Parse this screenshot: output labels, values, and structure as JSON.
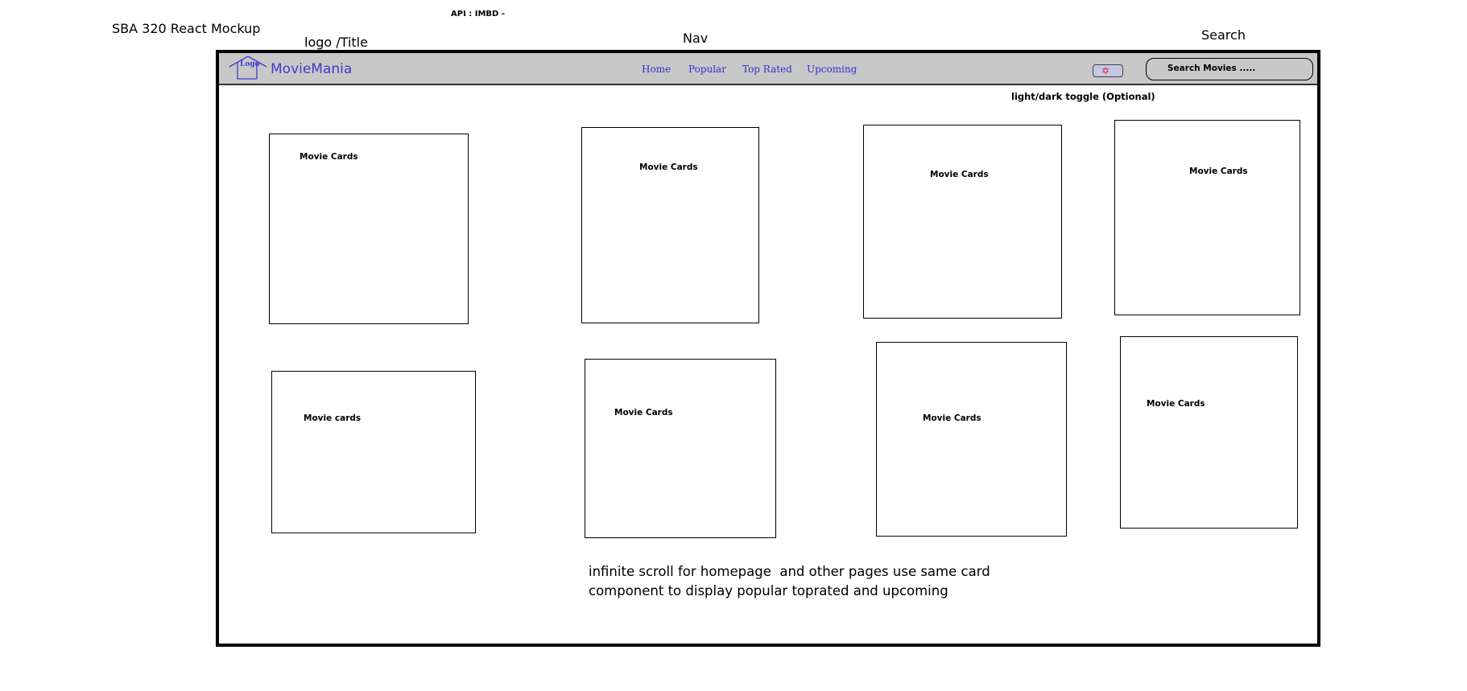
{
  "annotations": {
    "mockup_title": "SBA 320 React Mockup",
    "api_note": "API : IMBD -",
    "logo_title_label": "logo /Title",
    "nav_label": "Nav",
    "search_label": "Search",
    "toggle_label": "light/dark toggle (Optional)"
  },
  "header": {
    "logo_text": "Logo",
    "brand": "MovieMania",
    "nav_links": [
      "Home",
      "Popular",
      "Top Rated",
      "Upcoming"
    ],
    "toggle_icon": "sun-icon",
    "search_placeholder": "Search Movies ....."
  },
  "cards": [
    {
      "label": "Movie Cards"
    },
    {
      "label": "Movie Cards"
    },
    {
      "label": "Movie Cards"
    },
    {
      "label": "Movie Cards"
    },
    {
      "label": "Movie cards"
    },
    {
      "label": "Movie Cards"
    },
    {
      "label": "Movie Cards"
    },
    {
      "label": "Movie Cards"
    }
  ],
  "footer_note": {
    "line1": "infinite scroll for homepage  and other pages use same card",
    "line2": "component to display popular toprated and upcoming"
  },
  "colors": {
    "navbar_bg": "#c8c8c8",
    "brand": "#3c3ccf",
    "nav_link": "#3030d0",
    "toggle_icon": "#dd2222"
  }
}
